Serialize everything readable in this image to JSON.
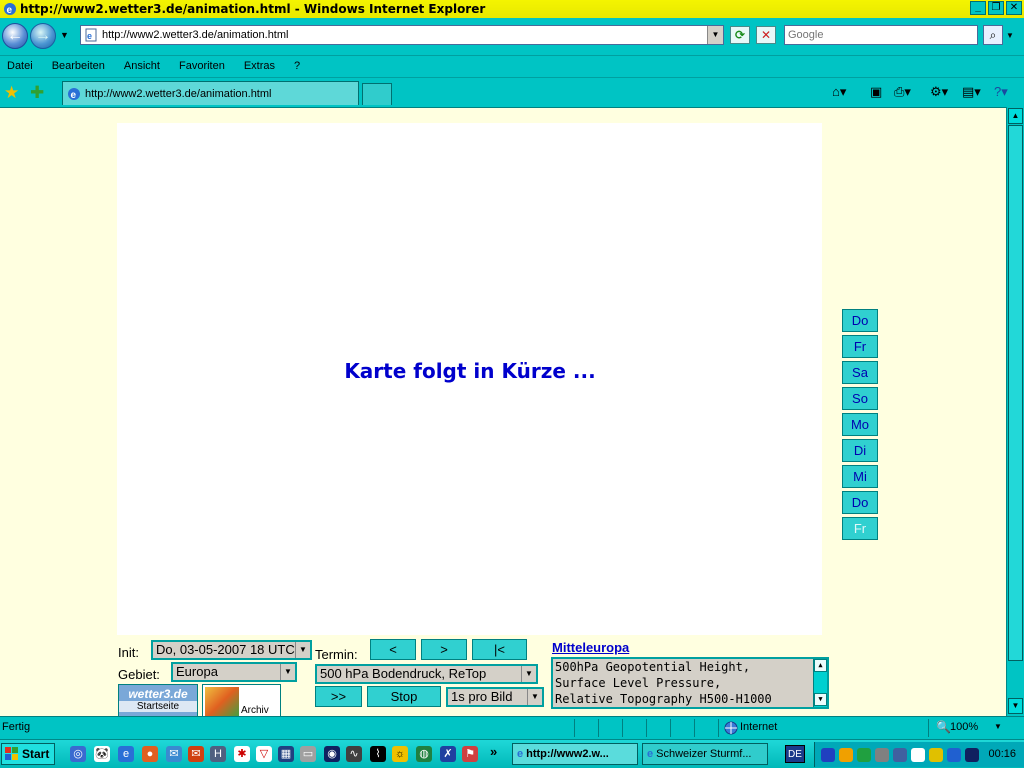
{
  "window": {
    "title": "http://www2.wetter3.de/animation.html - Windows Internet Explorer",
    "buttons": [
      "_",
      "❐",
      "✕"
    ]
  },
  "address": {
    "url": "http://www2.wetter3.de/animation.html",
    "search_placeholder": "Google"
  },
  "menu": [
    "Datei",
    "Bearbeiten",
    "Ansicht",
    "Favoriten",
    "Extras",
    "?"
  ],
  "tab": {
    "label": "http://www2.wetter3.de/animation.html"
  },
  "content": {
    "map_message": "Karte folgt in Kürze ...",
    "days": [
      "Do",
      "Fr",
      "Sa",
      "So",
      "Mo",
      "Di",
      "Mi",
      "Do",
      "Fr"
    ],
    "init_label": "Init:",
    "init_value": "Do, 03-05-2007 18 UTC",
    "gebiet_label": "Gebiet:",
    "gebiet_value": "Europa",
    "termin_label": "Termin:",
    "nav_prev": "<",
    "nav_next": ">",
    "nav_first": "|<",
    "product_value": "500 hPa Bodendruck, ReTop",
    "play": ">>",
    "stop": "Stop",
    "speed_value": "1s pro Bild",
    "thumb1_logo": "wetter3.de",
    "thumb1_label": "Startseite",
    "thumb2_label": "Archiv",
    "region_link": "Mitteleuropa",
    "description": [
      "500hPa Geopotential Height,",
      "Surface Level Pressure,",
      "Relative Topography H500-H1000"
    ]
  },
  "status": {
    "text": "Fertig",
    "zone": "Internet",
    "zoom": "100%"
  },
  "taskbar": {
    "start": "Start",
    "chevron": "»",
    "tasks": [
      "http://www2.w...",
      "Schweizer Sturmf..."
    ],
    "lang": "DE",
    "clock": "00:16"
  }
}
